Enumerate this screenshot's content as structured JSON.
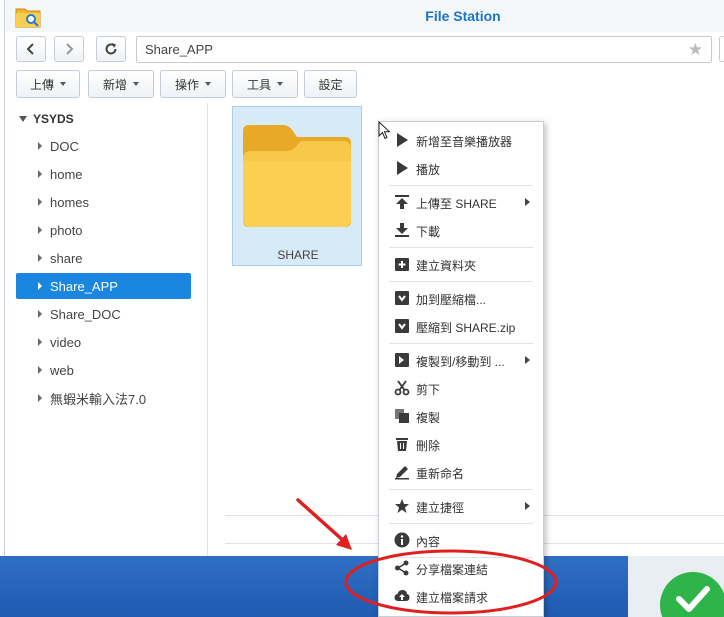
{
  "window": {
    "title": "File Station"
  },
  "navbar": {
    "path": "Share_APP"
  },
  "toolbar": {
    "upload": "上傳",
    "create": "新增",
    "action": "操作",
    "tools": "工具",
    "settings": "設定"
  },
  "sidebar": {
    "root": "YSYDS",
    "items": [
      {
        "label": "DOC"
      },
      {
        "label": "home"
      },
      {
        "label": "homes"
      },
      {
        "label": "photo"
      },
      {
        "label": "share"
      },
      {
        "label": "Share_APP"
      },
      {
        "label": "Share_DOC"
      },
      {
        "label": "video"
      },
      {
        "label": "web"
      },
      {
        "label": "無蝦米輸入法7.0"
      }
    ],
    "selected": "Share_APP"
  },
  "content": {
    "folder": {
      "name": "SHARE"
    }
  },
  "context_menu": {
    "items": [
      {
        "label": "新增至音樂播放器",
        "icon": "play-icon"
      },
      {
        "label": "播放",
        "icon": "play-icon"
      },
      {
        "label": "上傳至 SHARE",
        "icon": "upload-icon"
      },
      {
        "label": "下載",
        "icon": "download-icon"
      },
      {
        "label": "建立資料夾",
        "icon": "add-folder-icon"
      },
      {
        "label": "加到壓縮檔...",
        "icon": "archive-icon"
      },
      {
        "label": "壓縮到 SHARE.zip",
        "icon": "archive-icon"
      },
      {
        "label": "複製到/移動到 ...",
        "icon": "copy-move-icon"
      },
      {
        "label": "剪下",
        "icon": "scissors-icon"
      },
      {
        "label": "複製",
        "icon": "copy-icon"
      },
      {
        "label": "刪除",
        "icon": "trash-icon"
      },
      {
        "label": "重新命名",
        "icon": "pencil-icon"
      },
      {
        "label": "建立捷徑",
        "icon": "star-icon"
      },
      {
        "label": "內容",
        "icon": "info-icon"
      },
      {
        "label": "分享檔案連結",
        "icon": "share-icon"
      },
      {
        "label": "建立檔案請求",
        "icon": "cloud-upload-icon"
      }
    ]
  },
  "colors": {
    "accent": "#1d74c6",
    "selection": "#1a86e0",
    "annotation": "#e0201f"
  }
}
